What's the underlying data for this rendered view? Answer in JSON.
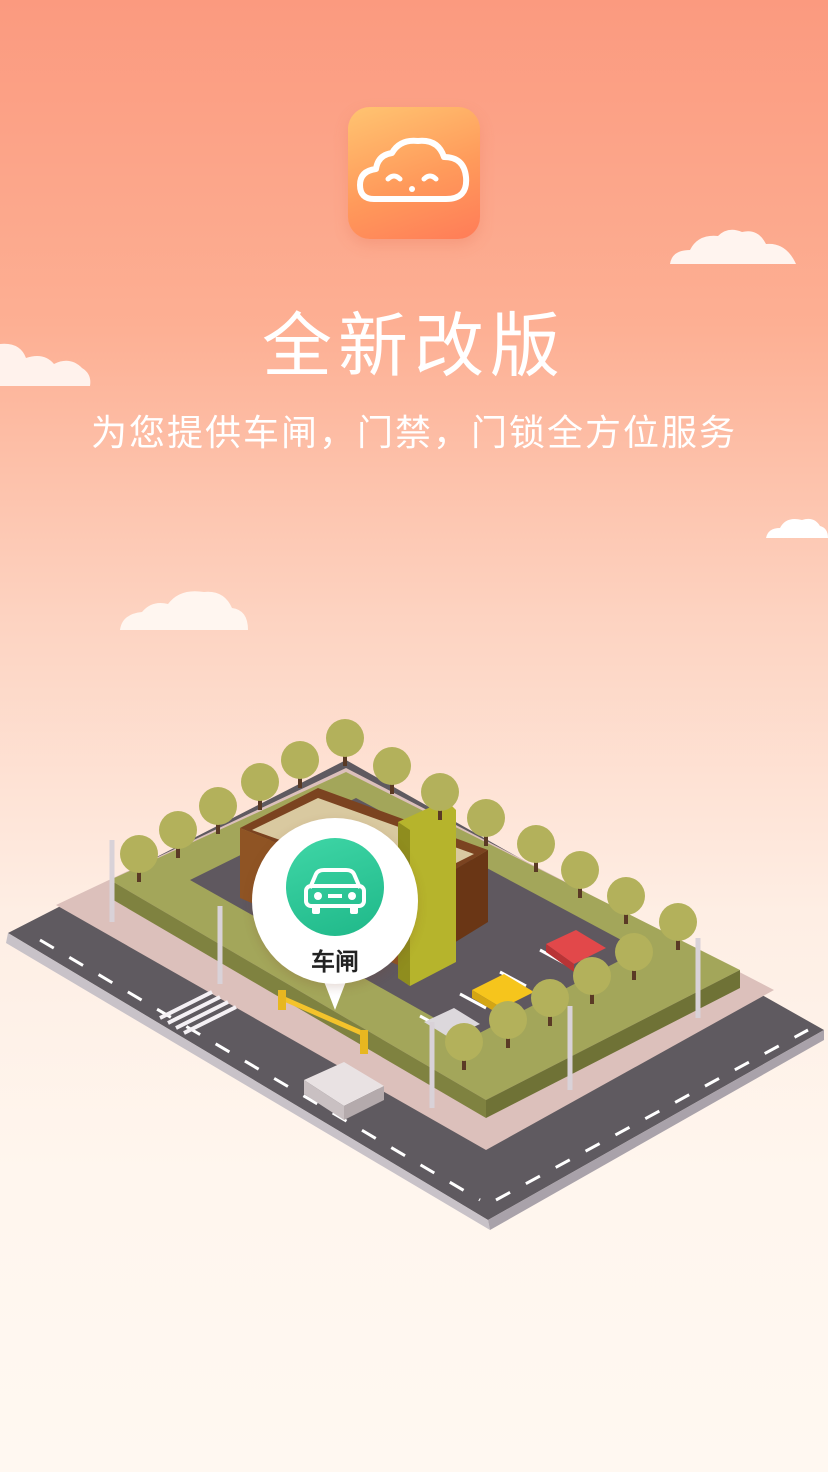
{
  "hero": {
    "title": "全新改版",
    "subtitle": "为您提供车闸，门禁，门锁全方位服务"
  },
  "app_icon": {
    "name": "cloud-smile-icon",
    "colors": [
      "#ffc471",
      "#ff7c58"
    ]
  },
  "feature_pin": {
    "icon": "car-icon",
    "label": "车闸",
    "color": "#2cc796"
  },
  "colors": {
    "background_top": "#fb9a7f",
    "background_bottom": "#fff8f1",
    "text": "#ffffff"
  }
}
